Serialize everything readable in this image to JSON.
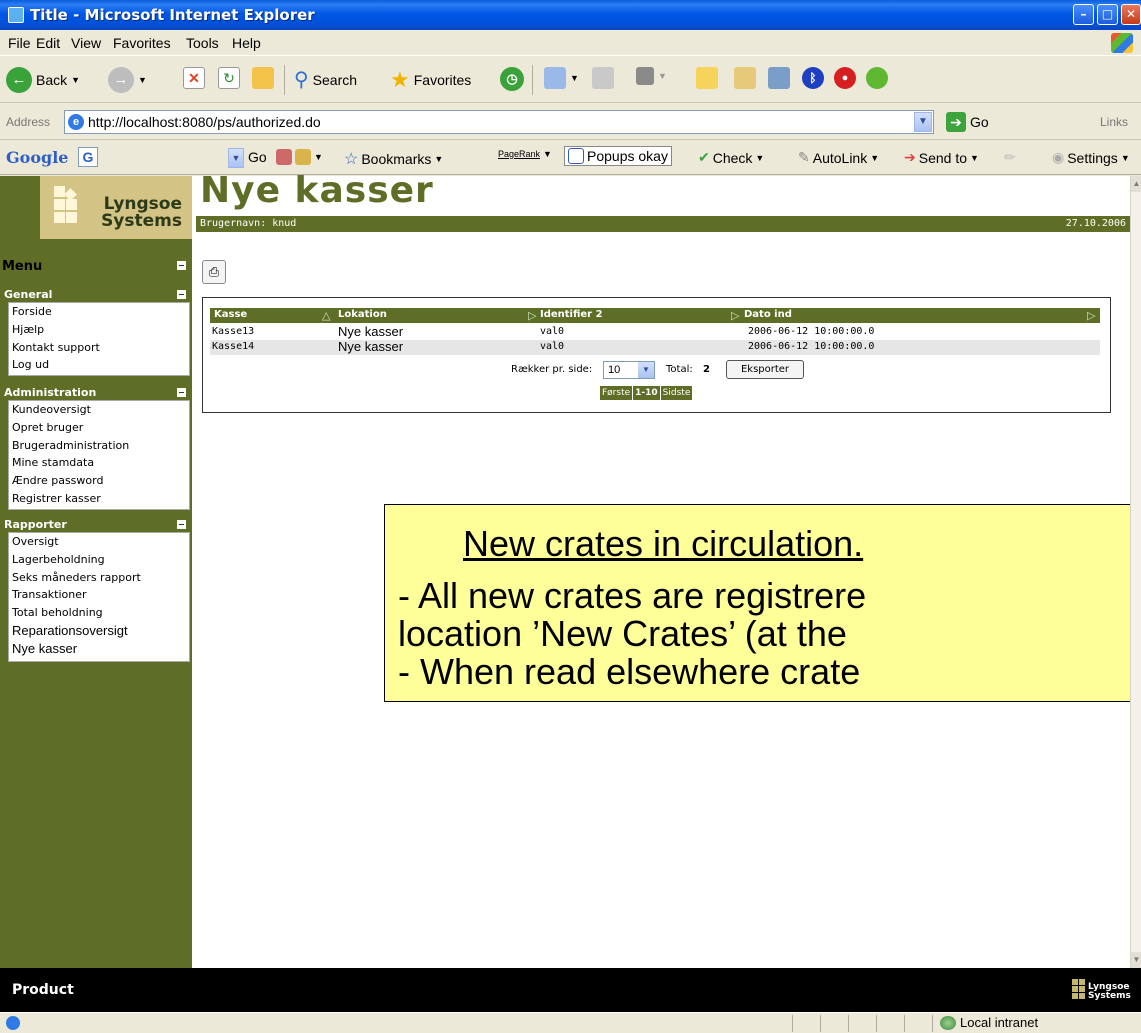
{
  "window": {
    "title": "Title - Microsoft Internet Explorer"
  },
  "menubar": {
    "items": [
      "File",
      "Edit",
      "View",
      "Favorites",
      "Tools",
      "Help"
    ]
  },
  "toolbar": {
    "back": "Back",
    "search": "Search",
    "favorites": "Favorites"
  },
  "address": {
    "label": "Address",
    "url": "http://localhost:8080/ps/authorized.do",
    "go": "Go",
    "links": "Links"
  },
  "googlebar": {
    "logo": "Google",
    "box": "G",
    "go": "Go",
    "bookmarks": "Bookmarks",
    "pagerank": "PageRank",
    "popups": "Popups okay",
    "check": "Check",
    "autolink": "AutoLink",
    "sendto": "Send to",
    "settings": "Settings"
  },
  "app": {
    "logo_line1": "Lyngsoe",
    "logo_line2": "Systems",
    "page_title": "Nye kasser",
    "username_label": "Brugernavn: knud",
    "date": "27.10.2006",
    "menu_title": "Menu",
    "sections": [
      {
        "title": "General",
        "items": [
          "Forside",
          "Hjælp",
          "Kontakt support",
          "Log ud"
        ]
      },
      {
        "title": "Administration",
        "items": [
          "Kundeoversigt",
          "Opret bruger",
          "Brugeradministration",
          "Mine stamdata",
          "Ændre password",
          "Registrer kasser"
        ]
      },
      {
        "title": "Rapporter",
        "items": [
          "Oversigt",
          "Lagerbeholdning",
          "Seks måneders rapport",
          "Transaktioner",
          "Total beholdning",
          "Reparationsoversigt",
          "Nye kasser"
        ]
      }
    ],
    "table": {
      "columns": [
        "Kasse",
        "Lokation",
        "Identifier 2",
        "Dato ind"
      ],
      "rows": [
        {
          "kasse": "Kasse13",
          "lokation": "Nye kasser",
          "id2": "val0",
          "dato": "2006-06-12 10:00:00.0"
        },
        {
          "kasse": "Kasse14",
          "lokation": "Nye kasser",
          "id2": "val0",
          "dato": "2006-06-12 10:00:00.0"
        }
      ],
      "rows_per_page_label": "Rækker pr. side:",
      "rows_per_page": "10",
      "total_label": "Total:",
      "total": "2",
      "export": "Eksporter",
      "pager": {
        "first": "Første",
        "range": "1-10",
        "last": "Sidste"
      }
    },
    "footer": "Product",
    "footer_logo_line1": "Lyngsoe",
    "footer_logo_line2": "Systems"
  },
  "callout": {
    "title": "New crates in circulation.",
    "line1": "- All new crates are registrere",
    "line2": "location ’New Crates’ (at the",
    "line3": "- When read elsewhere crate"
  },
  "status": {
    "zone": "Local intranet"
  }
}
